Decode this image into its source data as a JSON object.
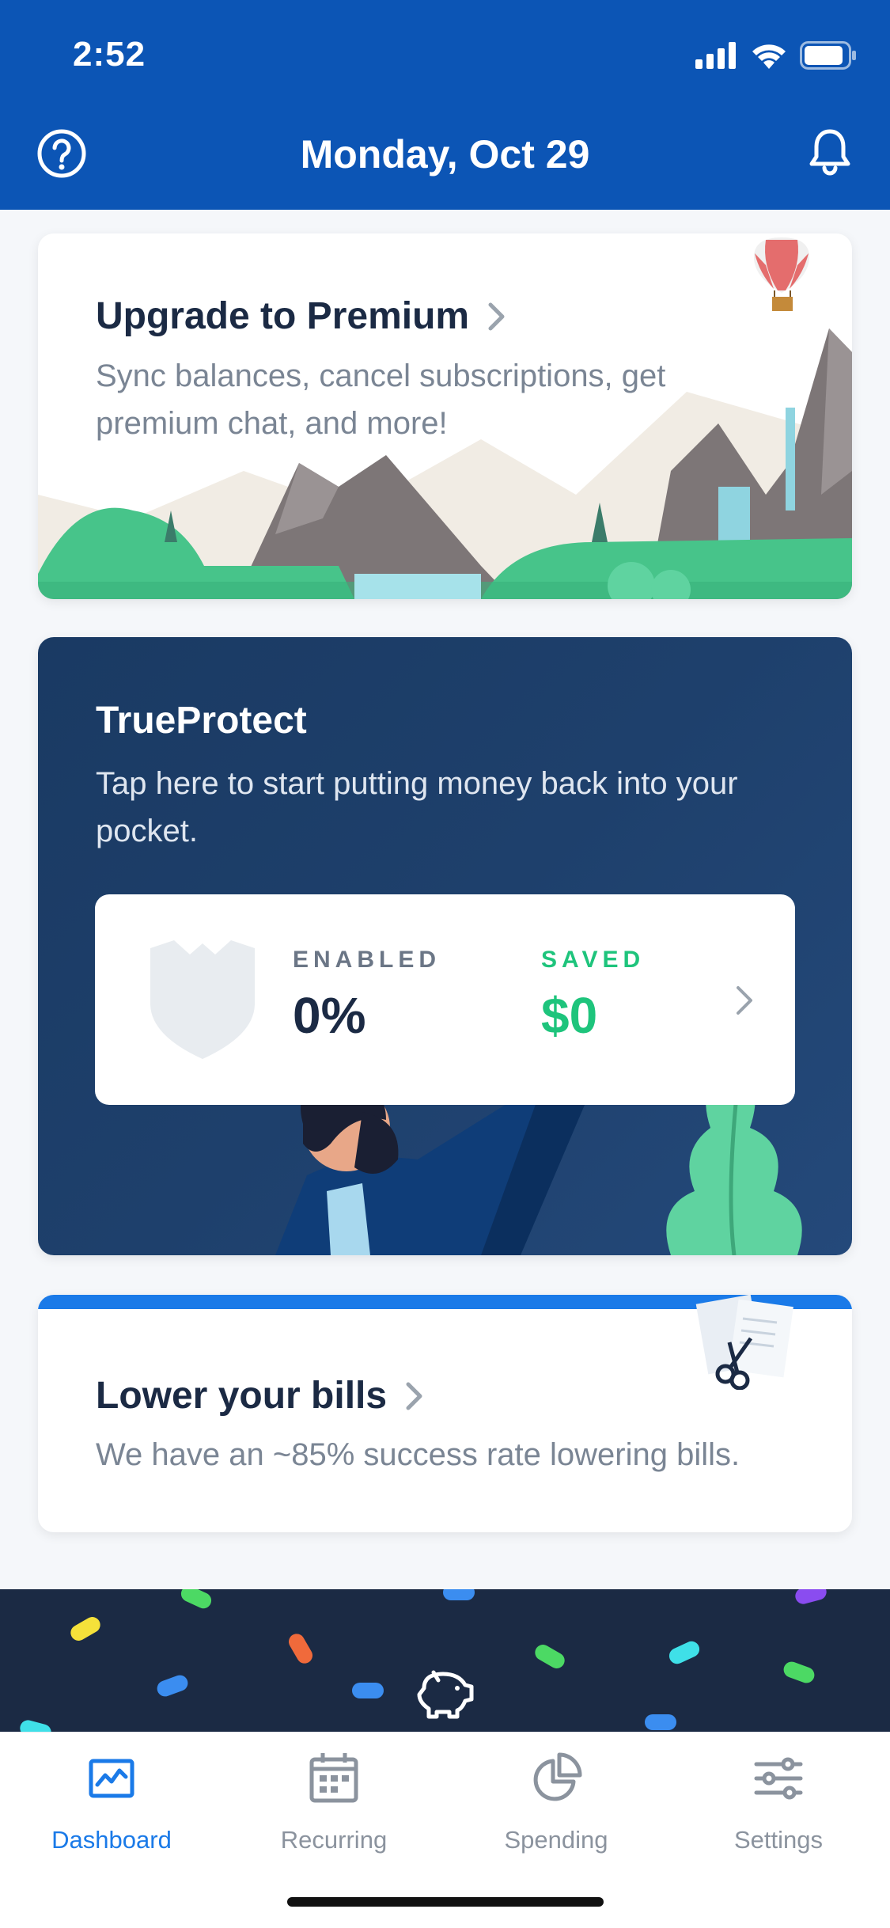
{
  "status_bar": {
    "time": "2:52"
  },
  "header": {
    "title": "Monday, Oct 29"
  },
  "premium_card": {
    "title": "Upgrade to Premium",
    "description": "Sync balances, cancel subscriptions, get premium chat, and more!"
  },
  "trueprotect_card": {
    "title": "TrueProtect",
    "description": "Tap here to start putting money back into your pocket.",
    "enabled_label": "ENABLED",
    "enabled_value": "0%",
    "saved_label": "SAVED",
    "saved_value": "$0"
  },
  "bills_card": {
    "title": "Lower your bills",
    "description": "We have an ~85% success rate lowering bills."
  },
  "tabs": [
    {
      "label": "Dashboard",
      "icon": "chart-icon",
      "active": true
    },
    {
      "label": "Recurring",
      "icon": "calendar-icon",
      "active": false
    },
    {
      "label": "Spending",
      "icon": "pie-chart-icon",
      "active": false
    },
    {
      "label": "Settings",
      "icon": "sliders-icon",
      "active": false
    }
  ],
  "colors": {
    "header_bg": "#0c55b5",
    "accent": "#1a7ae8",
    "saved_green": "#1ec47c",
    "dark_navy": "#1b2a44"
  }
}
